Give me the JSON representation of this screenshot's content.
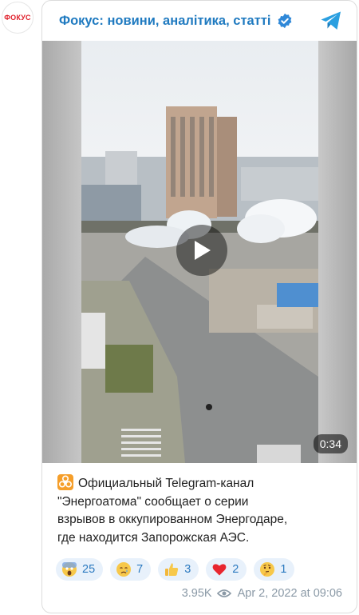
{
  "avatar": {
    "label": "ФОКУС"
  },
  "channel": {
    "name": "Фокус: новини, аналітика, статті",
    "verified": true
  },
  "video": {
    "duration": "0:34"
  },
  "post": {
    "lines": [
      "Официальный Telegram-канал",
      "\"Энергоатома\" сообщает о серии",
      "взрывов в оккупированном Энергодаре,",
      "где находится Запорожская АЭС."
    ],
    "lead_emoji": "biohazard-icon"
  },
  "reactions": [
    {
      "icon": "screaming-face-icon",
      "count": "25"
    },
    {
      "icon": "crying-face-icon",
      "count": "7"
    },
    {
      "icon": "thumbs-up-icon",
      "count": "3"
    },
    {
      "icon": "red-heart-icon",
      "count": "2"
    },
    {
      "icon": "thinking-face-icon",
      "count": "1"
    }
  ],
  "footer": {
    "views": "3.95K",
    "date": "Apr 2, 2022 at 09:06"
  },
  "colors": {
    "accent": "#1f7ac0",
    "reaction_bg": "#e8f1fb",
    "muted": "#8a99a6",
    "brand_red": "#e0202b"
  }
}
